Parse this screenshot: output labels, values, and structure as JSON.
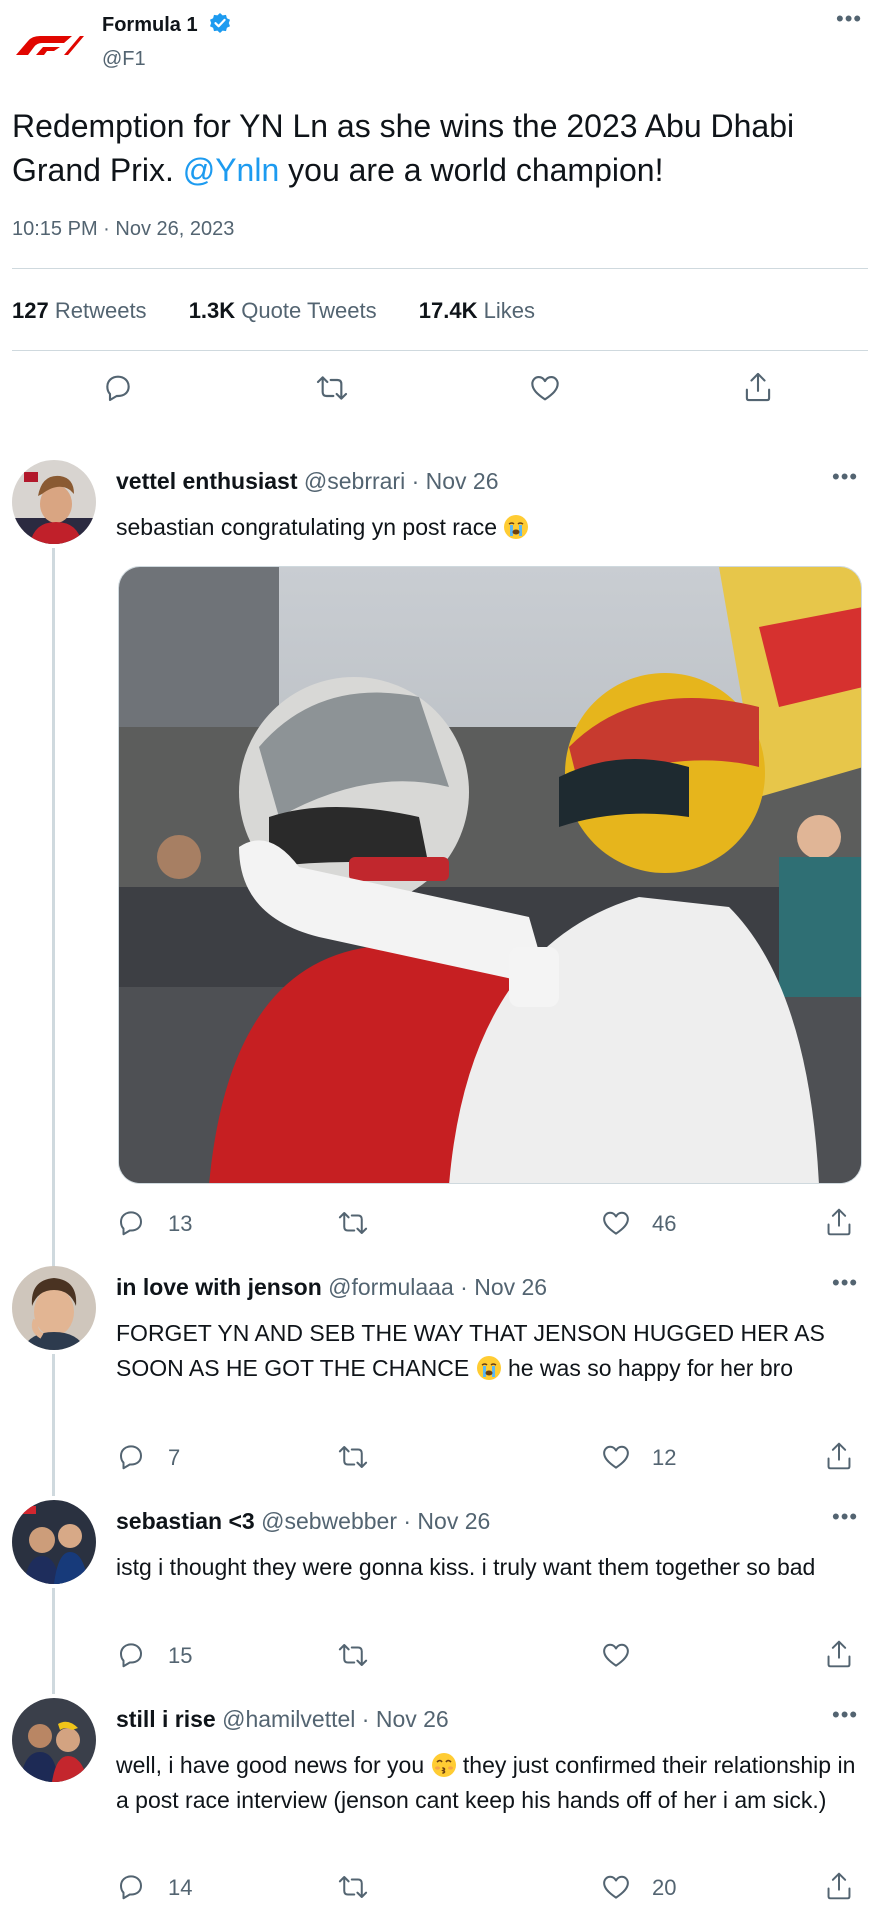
{
  "main_tweet": {
    "author_name": "Formula 1",
    "author_handle": "@F1",
    "logo_icon": "f1-logo",
    "verified_icon": "verified-badge-icon",
    "text_before": "Redemption for YN Ln as she wins the 2023 Abu Dhabi Grand Prix. ",
    "mention": "@Ynln",
    "text_after": " you are a world champion!",
    "timestamp": "10:15 PM · Nov 26, 2023",
    "stats": {
      "retweets_count": "127",
      "retweets_label": "Retweets",
      "quotes_count": "1.3K",
      "quotes_label": "Quote Tweets",
      "likes_count": "17.4K",
      "likes_label": "Likes"
    },
    "actions": [
      "reply-icon",
      "retweet-icon",
      "like-icon",
      "share-icon"
    ]
  },
  "replies": [
    {
      "name": "vettel enthusiast",
      "handle": "@sebrrari",
      "date": "· Nov 26",
      "text": "sebastian congratulating yn post race",
      "emoji": "loudly-crying-face",
      "has_photo": true,
      "reply_count": "13",
      "retweet_count": "",
      "like_count": "46"
    },
    {
      "name": "in love with jenson",
      "handle": "@formulaaa",
      "date": "· Nov 26",
      "text_before": "FORGET YN AND SEB THE WAY THAT JENSON HUGGED HER AS SOON AS HE GOT THE CHANCE ",
      "emoji": "loudly-crying-face",
      "text_after": " he was so happy for her bro",
      "reply_count": "7",
      "retweet_count": "",
      "like_count": "12"
    },
    {
      "name": "sebastian <3",
      "handle": "@sebwebber",
      "date": "· Nov 26",
      "text": "istg i thought they were gonna kiss. i truly want them together so bad",
      "reply_count": "15",
      "retweet_count": "",
      "like_count": ""
    },
    {
      "name": "still i rise",
      "handle": "@hamilvettel",
      "date": "· Nov 26",
      "text_before": "well, i have good news for you ",
      "emoji": "kissing-face",
      "text_after": " they just confirmed their relationship in a post race interview (jenson cant keep his hands off of her i am sick.)",
      "reply_count": "14",
      "retweet_count": "",
      "like_count": "20"
    }
  ],
  "colors": {
    "text": "#0f1419",
    "secondary": "#536471",
    "accent": "#1d9bf0",
    "divider": "#cfd9de",
    "f1_red": "#e10600"
  }
}
